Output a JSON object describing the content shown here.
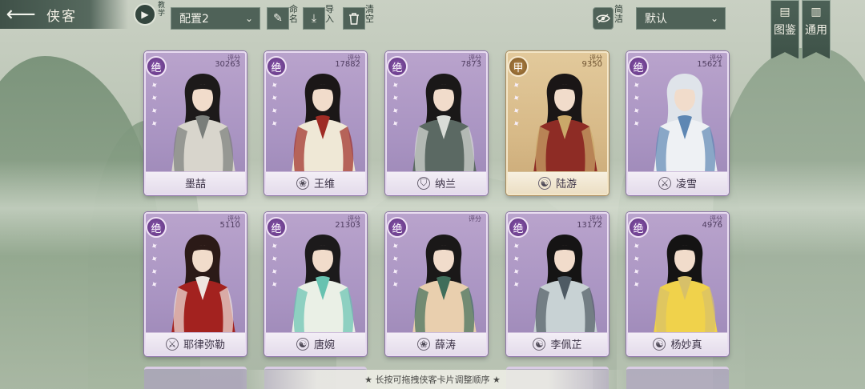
{
  "header": {
    "title": "侠客",
    "tutorial_label": "教学",
    "preset_value": "配置2",
    "rename_label": "命名",
    "import_label": "导入",
    "clear_label": "清空",
    "simple_label": "简洁",
    "sort_value": "默认",
    "atlas_tab": {
      "icon": "图",
      "label": "鉴"
    },
    "general_tab": {
      "icon": "通",
      "label": "用"
    }
  },
  "score_label": "评分",
  "cards": [
    {
      "name": "墨喆",
      "grade": "绝",
      "score": "30263",
      "sect_icon": "",
      "rarity": "purple",
      "robe": "#d8d5cc",
      "accent": "#7a7e7a",
      "hair": "#1d1a1a"
    },
    {
      "name": "王维",
      "grade": "绝",
      "score": "17882",
      "sect_icon": "lotus-icon",
      "rarity": "purple",
      "robe": "#efe8d6",
      "accent": "#9e2b24",
      "hair": "#1b1717"
    },
    {
      "name": "纳兰",
      "grade": "绝",
      "score": "7873",
      "sect_icon": "shield-icon",
      "rarity": "purple",
      "robe": "#5b6963",
      "accent": "#d9dcd7",
      "hair": "#1a1818"
    },
    {
      "name": "陆游",
      "grade": "甲",
      "score": "9350",
      "sect_icon": "yinyang-icon",
      "rarity": "gold",
      "robe": "#8e2c25",
      "accent": "#caa869",
      "hair": "#1a1616"
    },
    {
      "name": "凌雪",
      "grade": "绝",
      "score": "15621",
      "sect_icon": "sword-icon",
      "rarity": "purple",
      "robe": "#eef1f4",
      "accent": "#5e87b3",
      "hair": "#dfe4ea"
    },
    {
      "name": "耶律弥勒",
      "grade": "绝",
      "score": "5110",
      "sect_icon": "sword-icon",
      "rarity": "purple",
      "robe": "#a3221f",
      "accent": "#efe6e0",
      "hair": "#2b1a17"
    },
    {
      "name": "唐婉",
      "grade": "绝",
      "score": "21303",
      "sect_icon": "yinyang-icon",
      "rarity": "purple",
      "robe": "#eaf0e6",
      "accent": "#67c2b0",
      "hair": "#1c1a1b"
    },
    {
      "name": "薛涛",
      "grade": "绝",
      "score": "",
      "sect_icon": "lotus-icon",
      "rarity": "purple",
      "robe": "#e9cfae",
      "accent": "#3f6d5a",
      "hair": "#1a1818"
    },
    {
      "name": "李佩芷",
      "grade": "绝",
      "score": "13172",
      "sect_icon": "yinyang-icon",
      "rarity": "purple",
      "robe": "#c8d2d4",
      "accent": "#4e5a63",
      "hair": "#151414"
    },
    {
      "name": "杨妙真",
      "grade": "绝",
      "score": "4976",
      "sect_icon": "yinyang-icon",
      "rarity": "purple",
      "robe": "#f0d24b",
      "accent": "#d7c069",
      "hair": "#141313"
    }
  ],
  "hint": "★ 长按可拖拽侠客卡片调整顺序 ★"
}
